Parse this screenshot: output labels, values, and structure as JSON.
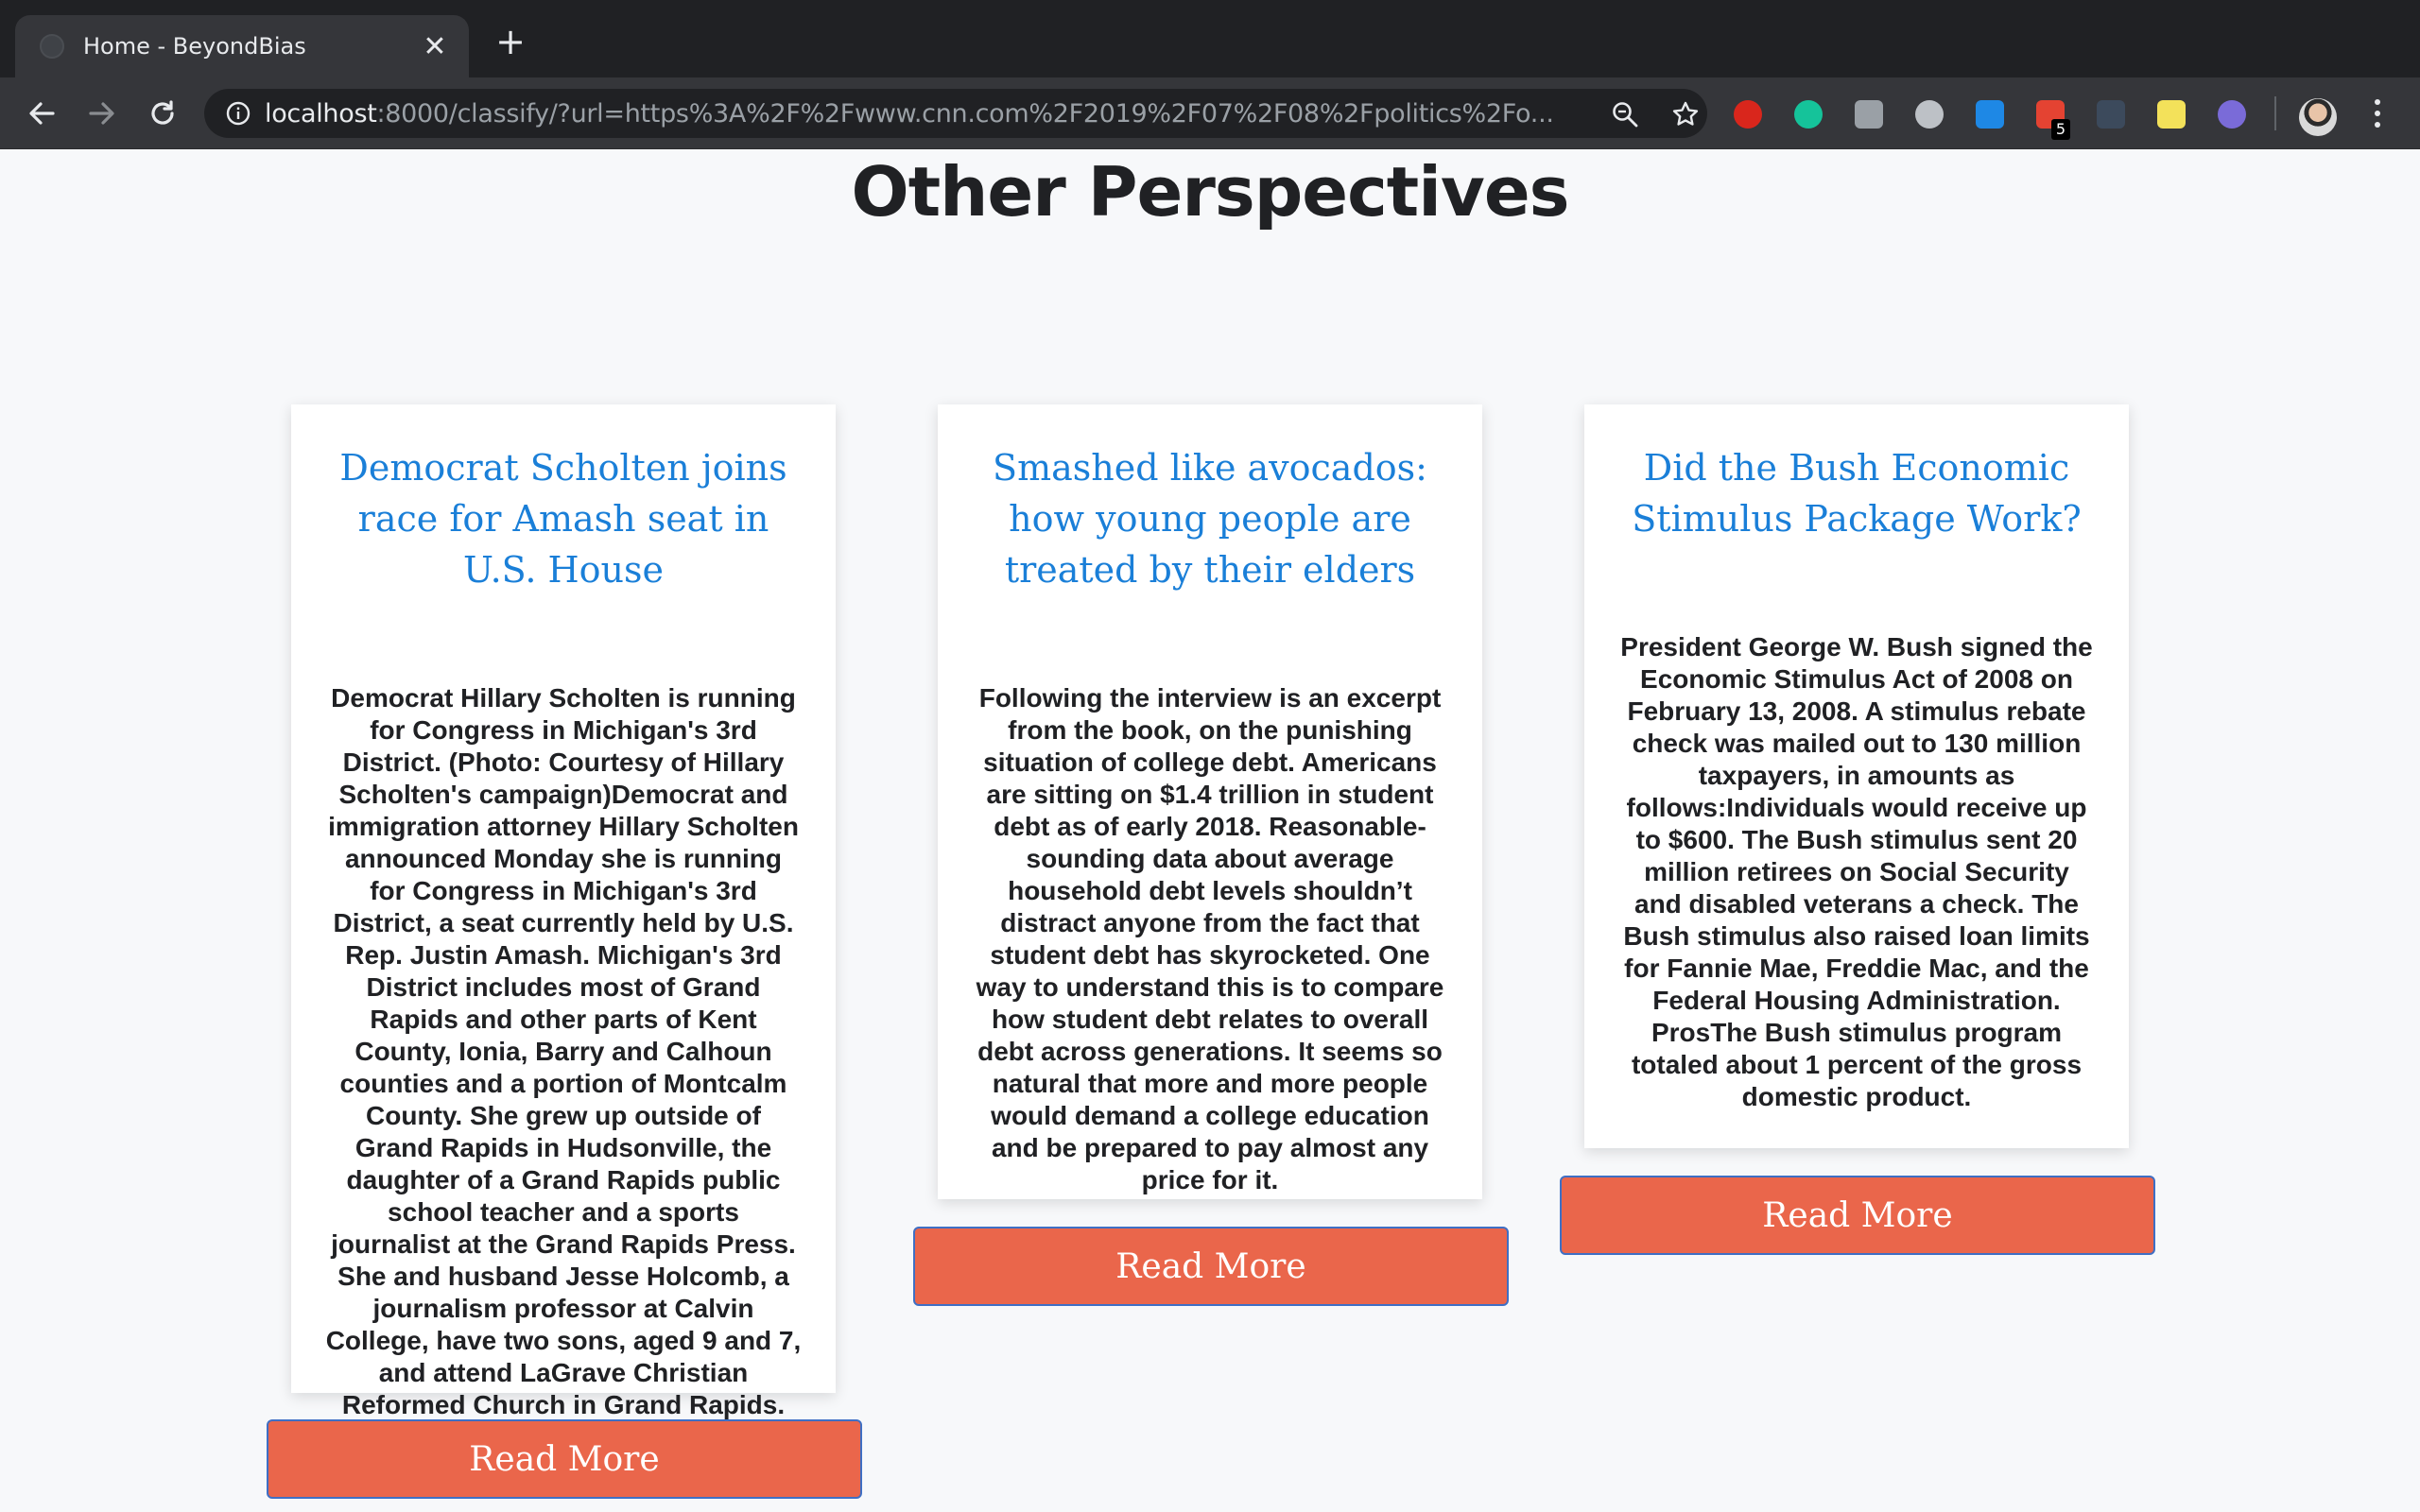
{
  "browser": {
    "tab_title": "Home - BeyondBias",
    "url_host": "localhost",
    "url_rest": ":8000/classify/?url=https%3A%2F%2Fwww.cnn.com%2F2019%2F07%2F08%2Fpolitics%2Fo...",
    "extension_badge": "5"
  },
  "page": {
    "title": "Other Perspectives"
  },
  "cards": [
    {
      "title": "Democrat Scholten joins race for Amash seat in U.S. House",
      "text": "Democrat Hillary Scholten is running for Congress in Michigan's 3rd District. (Photo: Courtesy of Hillary Scholten's campaign)Democrat and immigration attorney Hillary Scholten announced Monday she is running for Congress in Michigan's 3rd District, a seat currently held by U.S. Rep. Justin Amash. Michigan's 3rd District includes most of Grand Rapids and other parts of Kent County, Ionia, Barry and Calhoun counties and a portion of Montcalm County. She grew up outside of Grand Rapids in Hudsonville, the daughter of a Grand Rapids public school teacher and a sports journalist at the Grand Rapids Press. She and husband Jesse Holcomb, a journalism professor at Calvin College, have two sons, aged 9 and 7, and attend LaGrave Christian Reformed Church in Grand Rapids.",
      "button": "Read More"
    },
    {
      "title": "Smashed like avocados: how young people are treated by their elders",
      "text": "Following the interview is an excerpt from the book, on the punishing situation of college debt. Americans are sitting on $1.4 trillion in student debt as of early 2018. Reasonable-sounding data about average household debt levels shouldn’t distract anyone from the fact that student debt has skyrocketed. One way to understand this is to compare how student debt relates to overall debt across generations. It seems so natural that more and more people would demand a college education and be prepared to pay almost any price for it.",
      "button": "Read More"
    },
    {
      "title": "Did the Bush Economic Stimulus Package Work?",
      "text": "President George W. Bush signed the Economic Stimulus Act of 2008 on February 13, 2008. A stimulus rebate check was mailed out to 130 million taxpayers, in amounts as follows:Individuals would receive up to $600. The Bush stimulus sent 20 million retirees on Social Security and disabled veterans a check. The Bush stimulus also raised loan limits for Fannie Mae, Freddie Mac, and the Federal Housing Administration. ProsThe Bush stimulus program totaled about 1 percent of the gross domestic product.",
      "button": "Read More"
    }
  ]
}
